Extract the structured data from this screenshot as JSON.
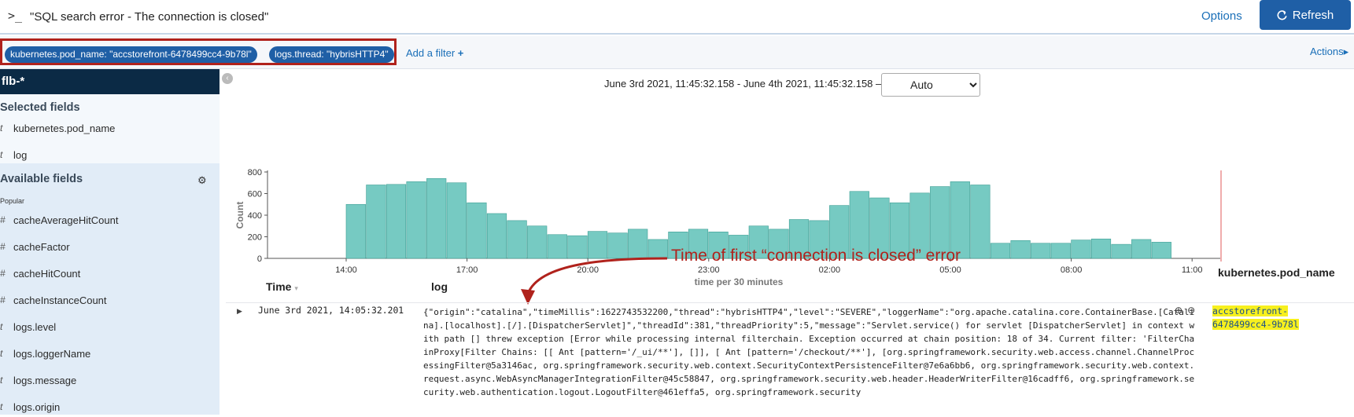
{
  "query_bar": {
    "prompt_symbol": ">_",
    "query": "\"SQL search error - The connection is closed\"",
    "options_label": "Options",
    "refresh_label": "Refresh",
    "refresh_icon": "refresh-icon"
  },
  "filters": {
    "pills": [
      {
        "label": "kubernetes.pod_name: \"accstorefront-6478499cc4-9b78l\""
      },
      {
        "label": "logs.thread: \"hybrisHTTP4\""
      }
    ],
    "add_filter_label": "Add a filter",
    "add_filter_icon": "+",
    "actions_label": "Actions"
  },
  "sidebar": {
    "index_pattern": "flb-*",
    "selected_title": "Selected fields",
    "selected_fields": [
      {
        "type": "t",
        "name": "kubernetes.pod_name"
      },
      {
        "type": "t",
        "name": "log"
      }
    ],
    "available_title": "Available fields",
    "popular_label": "Popular",
    "available_fields": [
      {
        "type": "#",
        "name": "cacheAverageHitCount"
      },
      {
        "type": "#",
        "name": "cacheFactor"
      },
      {
        "type": "#",
        "name": "cacheHitCount"
      },
      {
        "type": "#",
        "name": "cacheInstanceCount"
      },
      {
        "type": "t",
        "name": "logs.level"
      },
      {
        "type": "t",
        "name": "logs.loggerName"
      },
      {
        "type": "t",
        "name": "logs.message"
      },
      {
        "type": "t",
        "name": "logs.origin"
      }
    ]
  },
  "time_range": {
    "text": "June 3rd 2021, 11:45:32.158 - June 4th 2021, 11:45:32.158 —",
    "interval": "Auto"
  },
  "chart_data": {
    "type": "bar",
    "xlabel": "time per 30 minutes",
    "ylabel": "Count",
    "ylim": [
      0,
      800
    ],
    "yticks": [
      0,
      200,
      400,
      600,
      800
    ],
    "x_ticks": [
      "14:00",
      "17:00",
      "20:00",
      "23:00",
      "02:00",
      "05:00",
      "08:00",
      "11:00"
    ],
    "x_start": "14:00",
    "values": [
      500,
      680,
      685,
      710,
      740,
      700,
      515,
      415,
      350,
      300,
      220,
      210,
      250,
      235,
      270,
      175,
      245,
      270,
      245,
      215,
      300,
      270,
      360,
      350,
      490,
      620,
      560,
      515,
      605,
      665,
      710,
      680,
      140,
      165,
      140,
      140,
      170,
      180,
      130,
      175,
      150
    ],
    "color": "#76cac2",
    "stroke": "#3e9e94",
    "grid": false
  },
  "annotation": {
    "text": "Time of first “connection is closed” error",
    "color": "#b0221c"
  },
  "table": {
    "headers": {
      "time": "Time",
      "log": "log",
      "pod": "kubernetes.pod_name"
    },
    "row": {
      "time": "June 3rd 2021, 14:05:32.201",
      "log": "{\"origin\":\"catalina\",\"timeMillis\":1622743532200,\"thread\":\"hybrisHTTP4\",\"level\":\"SEVERE\",\"loggerName\":\"org.apache.catalina.core.ContainerBase.[Catalina].[localhost].[/].[DispatcherServlet]\",\"threadId\":381,\"threadPriority\":5,\"message\":\"Servlet.service() for servlet [DispatcherServlet] in context with path [] threw exception [Error while processing internal filterchain. Exception occurred at chain position: 18 of 34. Current filter: 'FilterChainProxy[Filter Chains: [[ Ant [pattern='/_ui/**'], []], [ Ant [pattern='/checkout/**'], [org.springframework.security.web.access.channel.ChannelProcessingFilter@5a3146ac, org.springframework.security.web.context.SecurityContextPersistenceFilter@7e6a6bb6, org.springframework.security.web.context.request.async.WebAsyncManagerIntegrationFilter@45c58847, org.springframework.security.web.header.HeaderWriterFilter@16cadff6, org.springframework.security.web.authentication.logout.LogoutFilter@461effa5, org.springframework.security",
      "pod_value": "accstorefront-6478499cc4-9b78l"
    }
  }
}
